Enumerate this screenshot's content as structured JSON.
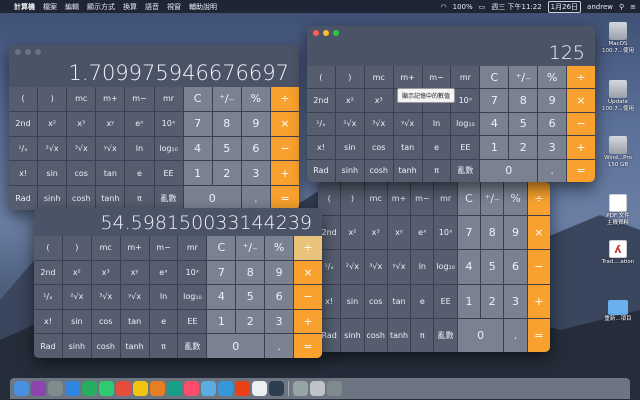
{
  "menubar": {
    "items": [
      "計算機",
      "檔案",
      "編輯",
      "顯示方式",
      "換算",
      "語音",
      "視窗",
      "輔助說明"
    ],
    "battery": "100%",
    "clock": "週三 下午11:22",
    "date": "1月26日",
    "user": "andrew"
  },
  "calc1": {
    "display": "1.709975946676697"
  },
  "calc2": {
    "display": "125",
    "tooltip": "顯示記憶中的數值"
  },
  "calc3": {
    "display": "54.598150033144239"
  },
  "keys": {
    "row1": [
      "(",
      ")",
      "mc",
      "m+",
      "m−",
      "mr",
      "C",
      "⁺∕₋",
      "%",
      "÷"
    ],
    "row2": [
      "2nd",
      "x²",
      "x³",
      "xʸ",
      "eˣ",
      "10ˣ",
      "7",
      "8",
      "9",
      "×"
    ],
    "row3": [
      "¹∕ₓ",
      "²√x",
      "³√x",
      "ʸ√x",
      "ln",
      "log₁₀",
      "4",
      "5",
      "6",
      "−"
    ],
    "row4": [
      "x!",
      "sin",
      "cos",
      "tan",
      "e",
      "EE",
      "1",
      "2",
      "3",
      "+"
    ],
    "row5": [
      "Rad",
      "sinh",
      "cosh",
      "tanh",
      "π",
      "亂數",
      "0",
      ".",
      "="
    ]
  },
  "desktop": {
    "icons": [
      {
        "label": "MacOS\n100.7...使用"
      },
      {
        "label": "Update\n100.7...使用"
      },
      {
        "label": "Wind...Pro\n150 GB"
      },
      {
        "label": "PDF 文件\n主機資料"
      },
      {
        "label": "Trad....ation"
      },
      {
        "label": "重新...項目"
      }
    ]
  },
  "dock": {
    "apps": [
      "finder-icon",
      "siri-icon",
      "launchpad-icon",
      "safari-icon",
      "chrome-icon",
      "messages-icon",
      "calendar-icon",
      "notes-icon",
      "photos-icon",
      "facetime-icon",
      "music-icon",
      "mail-icon",
      "app-store-icon",
      "trello-icon",
      "notion-icon",
      "terminal-icon",
      "calculator-icon",
      "preview-icon",
      "trash-icon"
    ]
  }
}
